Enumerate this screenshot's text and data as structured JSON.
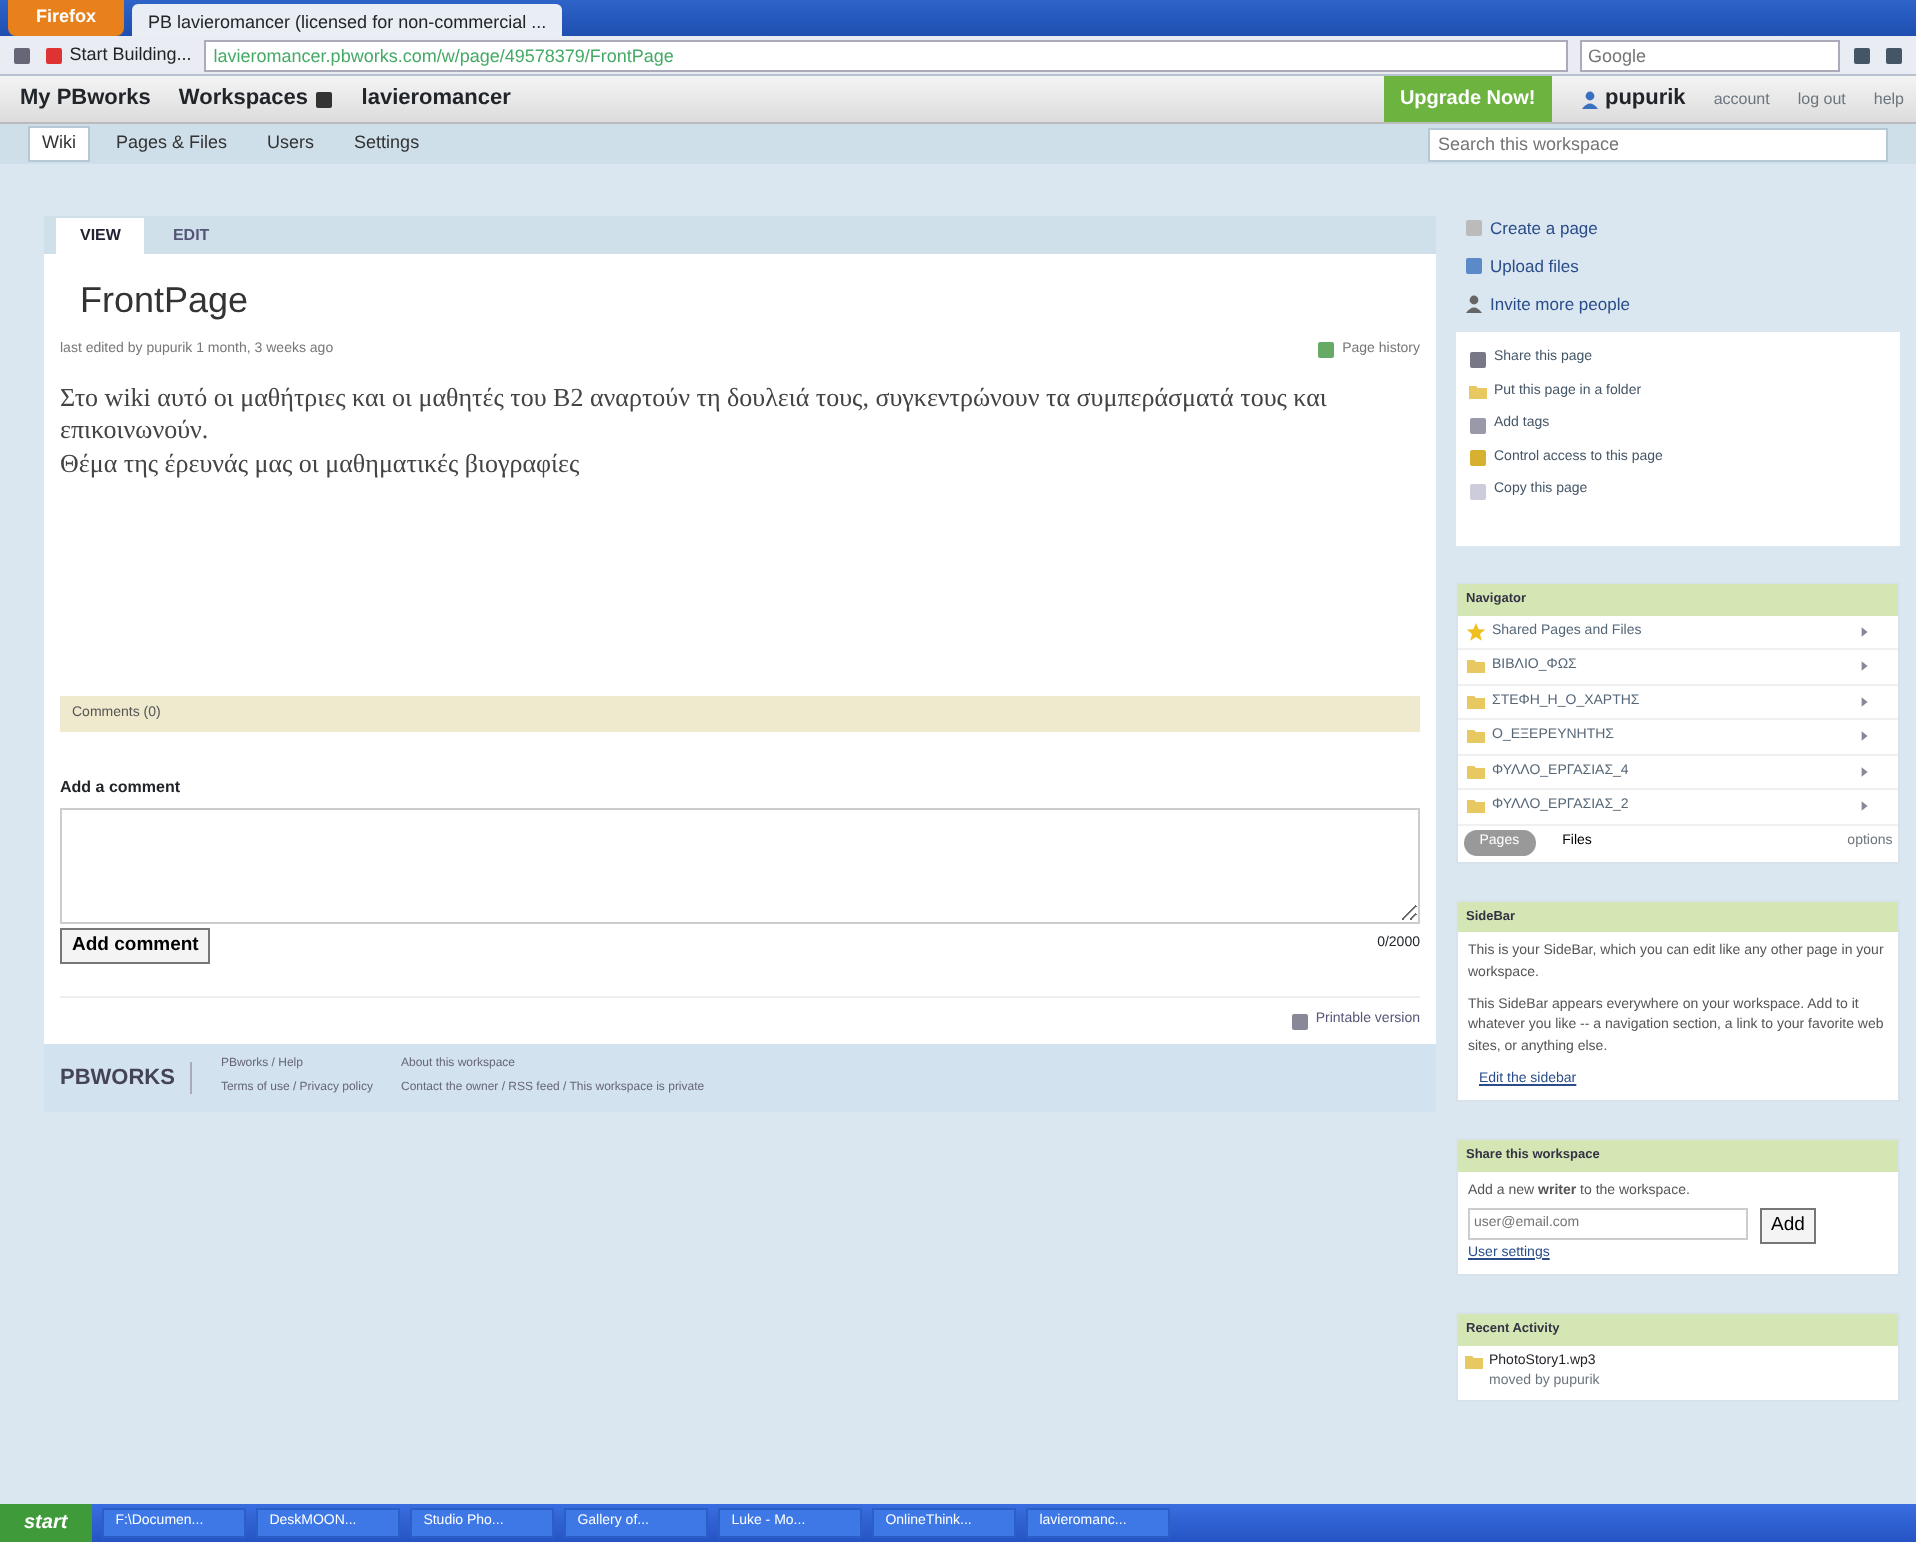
{
  "browser": {
    "app_button": "Firefox",
    "tab_title": "PB lavieromancer (licensed for non-commercial ...",
    "address": "lavieromancer.pbworks.com/w/page/49578379/FrontPage",
    "bookmark": "Start Building...",
    "search_placeholder": "Google"
  },
  "topbar": {
    "my_pbworks": "My PBworks",
    "workspaces": "Workspaces",
    "workspace_name": "lavieromancer",
    "upgrade": "Upgrade Now!",
    "user": "pupurik",
    "links": [
      "account",
      "log out",
      "help"
    ]
  },
  "tabs": [
    {
      "label": "Wiki",
      "selected": true
    },
    {
      "label": "Pages & Files",
      "selected": false
    },
    {
      "label": "Users",
      "selected": false
    },
    {
      "label": "Settings",
      "selected": false
    }
  ],
  "workspace_search": {
    "placeholder": "Search this workspace"
  },
  "page_tabs": [
    {
      "label": "VIEW",
      "selected": true
    },
    {
      "label": "EDIT",
      "selected": false
    }
  ],
  "page": {
    "title": "FrontPage",
    "edited_prefix": "last edited by",
    "edited_user": "pupurik",
    "edited_when": "1 month, 3 weeks ago",
    "history": "Page history",
    "body": [
      "Στο wiki αυτό οι μαθήτριες και οι μαθητές του Β2 αναρτούν τη δουλειά τους, συγκεντρώνουν τα συμπεράσματά τους και επικοινωνούν.",
      "Θέμα της έρευνάς μας οι μαθηματικές βιογραφίες"
    ]
  },
  "comments": {
    "header": "Comments (0)",
    "add_label": "Add a comment",
    "button": "Add comment",
    "counter": "0/2000",
    "printable": "Printable version"
  },
  "footer": {
    "logo": "PBWORKS",
    "links_1": [
      "PBworks / Help",
      "Terms of use / Privacy policy"
    ],
    "links_2": [
      "About this workspace",
      "Contact the owner / RSS feed / This workspace is private"
    ]
  },
  "actions": [
    "Create a page",
    "Upload files",
    "Invite more people"
  ],
  "page_actions": [
    "Share this page",
    "Put this page in a folder",
    "Add tags",
    "Control access to this page",
    "Copy this page"
  ],
  "navigator": {
    "title": "Navigator",
    "items": [
      {
        "label": "Shared Pages and Files",
        "kind": "shared"
      },
      {
        "label": "ΒΙΒΛΙΟ_ΦΩΣ",
        "kind": "folder"
      },
      {
        "label": "ΣΤΕΦΗ_Η_Ο_ΧΑΡΤΗΣ",
        "kind": "folder"
      },
      {
        "label": "Ο_ΕΞΕΡΕΥΝΗΤΗΣ",
        "kind": "folder"
      },
      {
        "label": "ΦΥΛΛΟ_ΕΡΓΑΣΙΑΣ_4",
        "kind": "folder"
      },
      {
        "label": "ΦΥΛΛΟ_ΕΡΓΑΣΙΑΣ_2",
        "kind": "folder"
      }
    ],
    "views": [
      {
        "label": "Pages",
        "selected": true
      },
      {
        "label": "Files",
        "selected": false
      }
    ],
    "options": "options"
  },
  "sidebar": {
    "title": "SideBar",
    "paragraphs": [
      "This is your SideBar, which you can edit like any other page in your workspace.",
      "This SideBar appears everywhere on your workspace. Add to it whatever you like -- a navigation section, a link to your favorite web sites, or anything else."
    ],
    "edit_link": "Edit the sidebar"
  },
  "share": {
    "title": "Share this workspace",
    "text": "Add a new **writer** to the workspace.",
    "placeholder": "user@email.com",
    "button": "Add",
    "link": "User settings"
  },
  "recent": {
    "title": "Recent Activity",
    "items": [
      {
        "name": "PhotoStory1.wp3",
        "detail": "moved by pupurik"
      }
    ]
  },
  "taskbar": {
    "start": "start",
    "windows": [
      "F:\\Documen...",
      "DeskMOON...",
      "Studio Pho...",
      "Gallery of...",
      "Luke - Mo...",
      "OnlineThink...",
      "lavieromanc..."
    ]
  }
}
